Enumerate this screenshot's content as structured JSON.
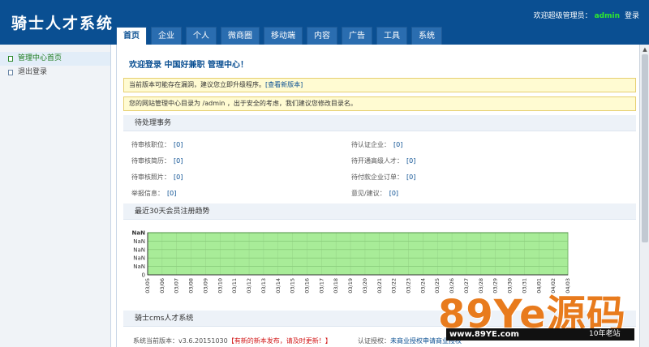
{
  "header": {
    "logo": "骑士人才系统",
    "welcome_prefix": "欢迎超级管理员：",
    "username": "admin",
    "logout": "登录"
  },
  "tabs": [
    {
      "label": "首页",
      "active": true
    },
    {
      "label": "企业"
    },
    {
      "label": "个人"
    },
    {
      "label": "微商圈"
    },
    {
      "label": "移动端"
    },
    {
      "label": "内容"
    },
    {
      "label": "广告"
    },
    {
      "label": "工具"
    },
    {
      "label": "系统"
    }
  ],
  "sidebar": {
    "items": [
      {
        "label": "管理中心首页"
      },
      {
        "label": "退出登录"
      }
    ]
  },
  "main": {
    "title": "欢迎登录 中国好兼职 管理中心！",
    "notice1_text": "当前版本可能存在漏洞，建议您立即升级程序。",
    "notice1_link": "[查看新版本]",
    "notice2_text": "您的网站管理中心目录为 /admin ，出于安全的考虑，我们建议您修改目录名。",
    "pending_title": "待处理事务",
    "pending_left": [
      {
        "label": "待审核职位：",
        "value": "[0]"
      },
      {
        "label": "待审核简历：",
        "value": "[0]"
      },
      {
        "label": "待审核照片：",
        "value": "[0]"
      },
      {
        "label": "举报信息：",
        "value": "[0]"
      }
    ],
    "pending_right": [
      {
        "label": "待认证企业：",
        "value": "[0]"
      },
      {
        "label": "待开通高级人才：",
        "value": "[0]"
      },
      {
        "label": "待付款企业订单：",
        "value": "[0]"
      },
      {
        "label": "意见/建议：",
        "value": "[0]"
      }
    ],
    "chart_title": "最近30天会员注册趋势",
    "system_title": "骑士cms人才系统",
    "version_label": "系统当前版本：",
    "version": "v3.6.20151030",
    "version_warning": "【有新的新本发布，请及时更新！】",
    "auth_label": "认证授权：",
    "auth_link": "未商业授权申请商业授权"
  },
  "chart_data": {
    "type": "area",
    "title": "最近30天会员注册趋势",
    "x": [
      "03/05",
      "03/06",
      "03/07",
      "03/08",
      "03/09",
      "03/10",
      "03/11",
      "03/12",
      "03/13",
      "03/14",
      "03/15",
      "03/16",
      "03/17",
      "03/18",
      "03/19",
      "03/20",
      "03/21",
      "03/22",
      "03/23",
      "03/24",
      "03/25",
      "03/26",
      "03/27",
      "03/28",
      "03/29",
      "03/30",
      "03/31",
      "04/01",
      "04/02",
      "04/03"
    ],
    "y_ticks": [
      "NaN",
      "NaN",
      "NaN",
      "NaN",
      "NaN",
      "0"
    ],
    "series": [
      {
        "values": [
          0,
          0,
          0,
          0,
          0,
          0,
          0,
          0,
          0,
          0,
          0,
          0,
          0,
          0,
          0,
          0,
          0,
          0,
          0,
          0,
          0,
          0,
          0,
          0,
          0,
          0,
          0,
          0,
          0,
          0
        ]
      }
    ],
    "fill_color": "#a8ec98",
    "grid": true
  },
  "watermark": {
    "big": "89Ye源码",
    "url": "www.89YE.com",
    "years": "10年老站"
  }
}
